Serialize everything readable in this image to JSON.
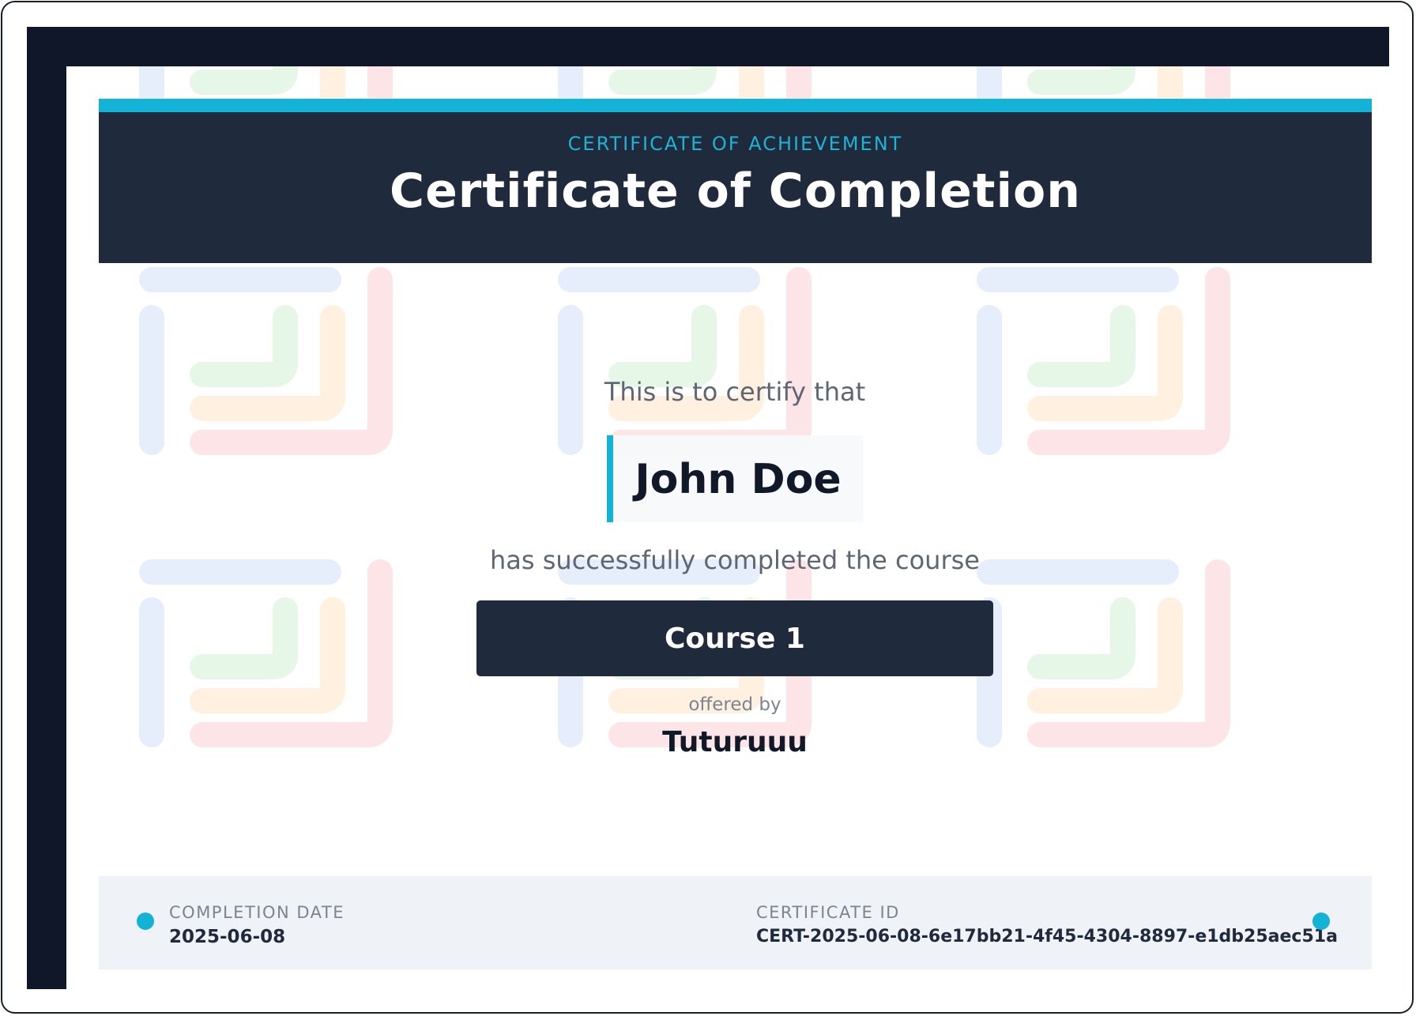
{
  "header": {
    "kicker": "CERTIFICATE OF ACHIEVEMENT",
    "title": "Certificate of Completion"
  },
  "body": {
    "certify_line": "This is to certify that",
    "recipient_name": "John Doe",
    "completed_line": "has successfully completed the course",
    "course_name": "Course 1",
    "offered_by_label": "offered by",
    "provider_name": "Tuturuuu"
  },
  "footer": {
    "completion_date_label": "COMPLETION DATE",
    "completion_date": "2025-06-08",
    "certificate_id_label": "CERTIFICATE ID",
    "certificate_id": "CERT-2025-06-08-6e17bb21-4f45-4304-8897-e1db25aec51a"
  },
  "colors": {
    "frame": "#0f1729",
    "header_bg": "#1f2a3c",
    "accent": "#12b3d6",
    "footer_bg": "#eff2f7",
    "pattern_blue": "#e6edfb",
    "pattern_orange": "#fff0df",
    "pattern_red": "#fde5e7",
    "pattern_green": "#e6f6e7"
  }
}
